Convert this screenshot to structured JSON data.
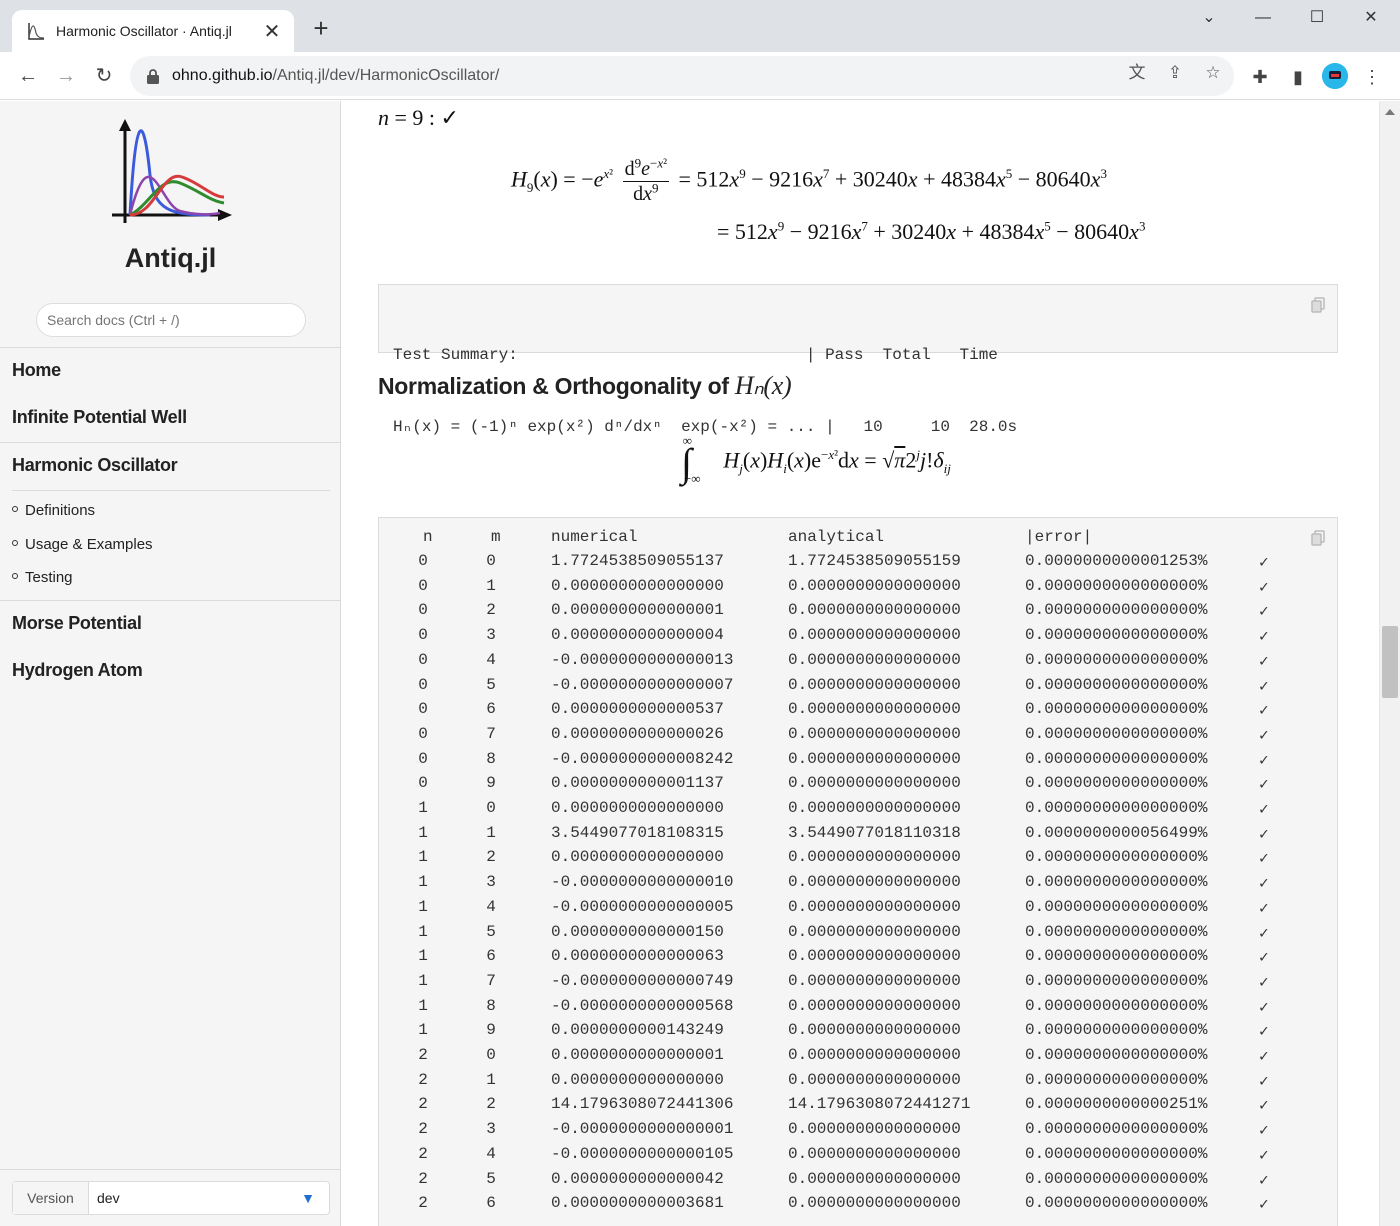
{
  "browser": {
    "tab_title": "Harmonic Oscillator · Antiq.jl",
    "url_host": "ohno.github.io",
    "url_path": "/Antiq.jl/dev/HarmonicOscillator/"
  },
  "sidebar": {
    "site_name": "Antiq.jl",
    "search_placeholder": "Search docs (Ctrl + /)",
    "nav": {
      "home": "Home",
      "ipw": "Infinite Potential Well",
      "ho": "Harmonic Oscillator",
      "sub": [
        "Definitions",
        "Usage & Examples",
        "Testing"
      ],
      "morse": "Morse Potential",
      "hydrogen": "Hydrogen Atom"
    },
    "version_label": "Version",
    "version_value": "dev"
  },
  "content": {
    "n9_label": "n = 9 : ✓",
    "test_summary": {
      "line1": "Test Summary:                              | Pass  Total   Time",
      "line2": "Hₙ(x) = (-1)ⁿ exp(x²) dⁿ/dxⁿ  exp(-x²) = ... |   10     10  28.0s"
    },
    "section_title": "Normalization & Orthogonality of ",
    "section_math": "Hₙ(x)",
    "table_header": {
      "n": "n",
      "m": "m",
      "numerical": "numerical",
      "analytical": "analytical",
      "error": "|error|"
    },
    "table_rows": [
      [
        "0",
        "0",
        "1.7724538509055137",
        "1.7724538509055159",
        "0.0000000000001253%",
        "✓"
      ],
      [
        "0",
        "1",
        "0.0000000000000000",
        "0.0000000000000000",
        "0.0000000000000000%",
        "✓"
      ],
      [
        "0",
        "2",
        "0.0000000000000001",
        "0.0000000000000000",
        "0.0000000000000000%",
        "✓"
      ],
      [
        "0",
        "3",
        "0.0000000000000004",
        "0.0000000000000000",
        "0.0000000000000000%",
        "✓"
      ],
      [
        "0",
        "4",
        "-0.0000000000000013",
        "0.0000000000000000",
        "0.0000000000000000%",
        "✓"
      ],
      [
        "0",
        "5",
        "-0.0000000000000007",
        "0.0000000000000000",
        "0.0000000000000000%",
        "✓"
      ],
      [
        "0",
        "6",
        "0.0000000000000537",
        "0.0000000000000000",
        "0.0000000000000000%",
        "✓"
      ],
      [
        "0",
        "7",
        "0.0000000000000026",
        "0.0000000000000000",
        "0.0000000000000000%",
        "✓"
      ],
      [
        "0",
        "8",
        "-0.0000000000008242",
        "0.0000000000000000",
        "0.0000000000000000%",
        "✓"
      ],
      [
        "0",
        "9",
        "0.0000000000001137",
        "0.0000000000000000",
        "0.0000000000000000%",
        "✓"
      ],
      [
        "1",
        "0",
        "0.0000000000000000",
        "0.0000000000000000",
        "0.0000000000000000%",
        "✓"
      ],
      [
        "1",
        "1",
        "3.5449077018108315",
        "3.5449077018110318",
        "0.0000000000056499%",
        "✓"
      ],
      [
        "1",
        "2",
        "0.0000000000000000",
        "0.0000000000000000",
        "0.0000000000000000%",
        "✓"
      ],
      [
        "1",
        "3",
        "-0.0000000000000010",
        "0.0000000000000000",
        "0.0000000000000000%",
        "✓"
      ],
      [
        "1",
        "4",
        "-0.0000000000000005",
        "0.0000000000000000",
        "0.0000000000000000%",
        "✓"
      ],
      [
        "1",
        "5",
        "0.0000000000000150",
        "0.0000000000000000",
        "0.0000000000000000%",
        "✓"
      ],
      [
        "1",
        "6",
        "0.0000000000000063",
        "0.0000000000000000",
        "0.0000000000000000%",
        "✓"
      ],
      [
        "1",
        "7",
        "-0.0000000000000749",
        "0.0000000000000000",
        "0.0000000000000000%",
        "✓"
      ],
      [
        "1",
        "8",
        "-0.0000000000000568",
        "0.0000000000000000",
        "0.0000000000000000%",
        "✓"
      ],
      [
        "1",
        "9",
        "0.0000000000143249",
        "0.0000000000000000",
        "0.0000000000000000%",
        "✓"
      ],
      [
        "2",
        "0",
        "0.0000000000000001",
        "0.0000000000000000",
        "0.0000000000000000%",
        "✓"
      ],
      [
        "2",
        "1",
        "0.0000000000000000",
        "0.0000000000000000",
        "0.0000000000000000%",
        "✓"
      ],
      [
        "2",
        "2",
        "14.1796308072441306",
        "14.1796308072441271",
        "0.0000000000000251%",
        "✓"
      ],
      [
        "2",
        "3",
        "-0.0000000000000001",
        "0.0000000000000000",
        "0.0000000000000000%",
        "✓"
      ],
      [
        "2",
        "4",
        "-0.0000000000000105",
        "0.0000000000000000",
        "0.0000000000000000%",
        "✓"
      ],
      [
        "2",
        "5",
        "0.0000000000000042",
        "0.0000000000000000",
        "0.0000000000000000%",
        "✓"
      ],
      [
        "2",
        "6",
        "0.0000000000003681",
        "0.0000000000000000",
        "0.0000000000000000%",
        "✓"
      ]
    ]
  },
  "icons": {
    "back": "arrow-left-icon",
    "forward": "arrow-right-icon",
    "reload": "reload-icon",
    "lock": "lock-icon",
    "translate": "translate-icon",
    "share": "share-icon",
    "star": "star-icon",
    "extensions": "puzzle-icon",
    "sidepanel": "side-panel-icon",
    "menu": "kebab-menu-icon",
    "copy": "copy-icon",
    "chevron": "chevron-down-icon"
  },
  "colors": {
    "accent": "#1f6fd1",
    "code_bg": "#f5f5f5",
    "sidebar_bg": "#f5f5f5"
  }
}
